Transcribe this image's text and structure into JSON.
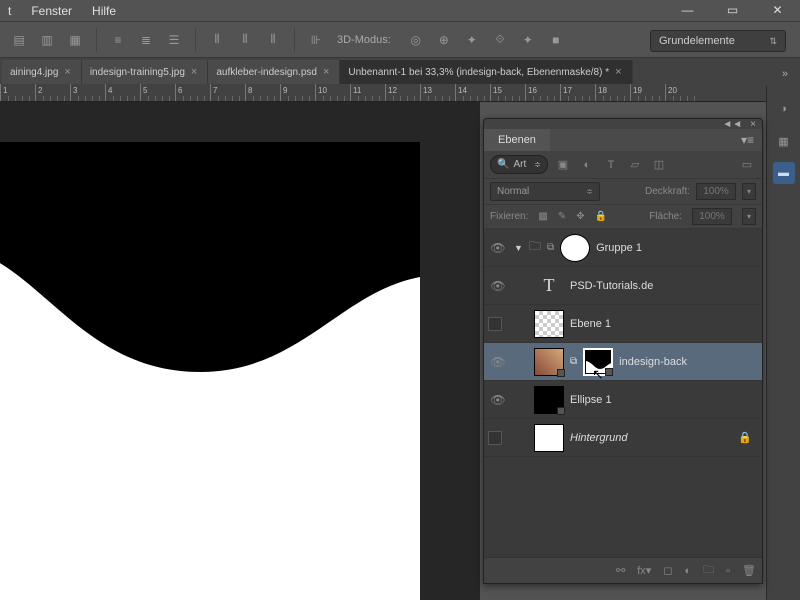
{
  "menu": {
    "fenster": "Fenster",
    "hilfe": "Hilfe"
  },
  "workspace": "Grundelemente",
  "mode3d_label": "3D-Modus:",
  "tabs": [
    {
      "label": "aining4.jpg"
    },
    {
      "label": "indesign-training5.jpg"
    },
    {
      "label": "aufkleber-indesign.psd"
    },
    {
      "label": "Unbenannt-1 bei 33,3% (indesign-back, Ebenenmaske/8) *"
    }
  ],
  "ruler_marks": [
    "1",
    "2",
    "3",
    "4",
    "5",
    "6",
    "7",
    "8",
    "9",
    "10",
    "11",
    "12",
    "13",
    "14",
    "15",
    "16",
    "17",
    "18",
    "19",
    "20"
  ],
  "panel": {
    "title": "Ebenen",
    "search": "Art",
    "blend": "Normal",
    "opacity_label": "Deckkraft:",
    "fill_label": "Fläche:",
    "opacity": "100%",
    "fill": "100%",
    "lock_label": "Fixieren:"
  },
  "layers": [
    {
      "name": "Gruppe 1"
    },
    {
      "name": "PSD-Tutorials.de"
    },
    {
      "name": "Ebene 1"
    },
    {
      "name": "indesign-back"
    },
    {
      "name": "Ellipse 1"
    },
    {
      "name": "Hintergrund"
    }
  ],
  "chart_data": null
}
